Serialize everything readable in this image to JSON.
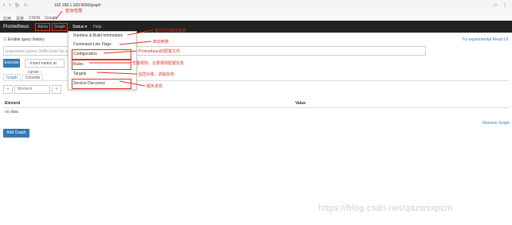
{
  "browser": {
    "url": "192.168.1.100:9090/graph",
    "nav_icons": [
      "back-icon",
      "forward-icon",
      "reload-icon",
      "home-icon"
    ]
  },
  "bookmarks": [
    "应用",
    "百度",
    "CSDN",
    "Google"
  ],
  "navbar": {
    "brand": "Prometheus",
    "links": [
      "Alerts",
      "Graph",
      "Status ▾",
      "Help"
    ],
    "annotation": "查询/告警"
  },
  "status_menu": {
    "items": [
      "Runtime & Build Information",
      "Command-Line Flags",
      "Configuration",
      "Rules",
      "Targets",
      "Service Discovery"
    ],
    "annotations": [
      "运行时及版本信息",
      "启动参数",
      "Prometheus的配置文件",
      "告警规则、记录规则配置信息",
      "监控对象，抓取状态",
      "服务发现"
    ]
  },
  "query": {
    "enable_query_history": "Enable query history",
    "help_link": "Try experimental React UI",
    "placeholder": "Expression (press Shift+Enter for newlines)",
    "execute_label": "Execute",
    "insert_label": "- insert metric at cursor -",
    "tabs": [
      "Graph",
      "Console"
    ],
    "moment_placeholder": "Moment",
    "table_headers": [
      "Element",
      "Value"
    ],
    "no_data": "no data",
    "remove_graph": "Remove Graph",
    "add_graph": "Add Graph"
  },
  "watermark": "https://blog.csdn.net/qazwsxpcm"
}
